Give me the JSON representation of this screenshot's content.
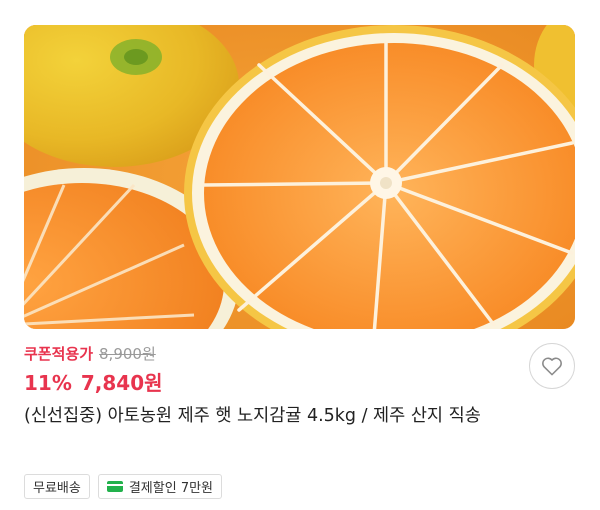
{
  "product": {
    "image": {
      "subject": "sliced-mandarin-photo"
    },
    "price": {
      "coupon_label": "쿠폰적용가",
      "original_price": "8,900원",
      "discount_rate": "11%",
      "final_price": "7,840원"
    },
    "title": "(신선집중) 아토농원 제주 햇 노지감귤 4.5kg / 제주 산지 직송",
    "tags": [
      {
        "label": "무료배송",
        "icon": ""
      },
      {
        "label": "결제할인 7만원",
        "icon": "credit-card-icon"
      }
    ],
    "wishlist_icon": "heart-icon"
  },
  "colors": {
    "accent_red": "#e8344e",
    "muted_gray": "#9a9a9a",
    "card_green": "#22b14c"
  }
}
